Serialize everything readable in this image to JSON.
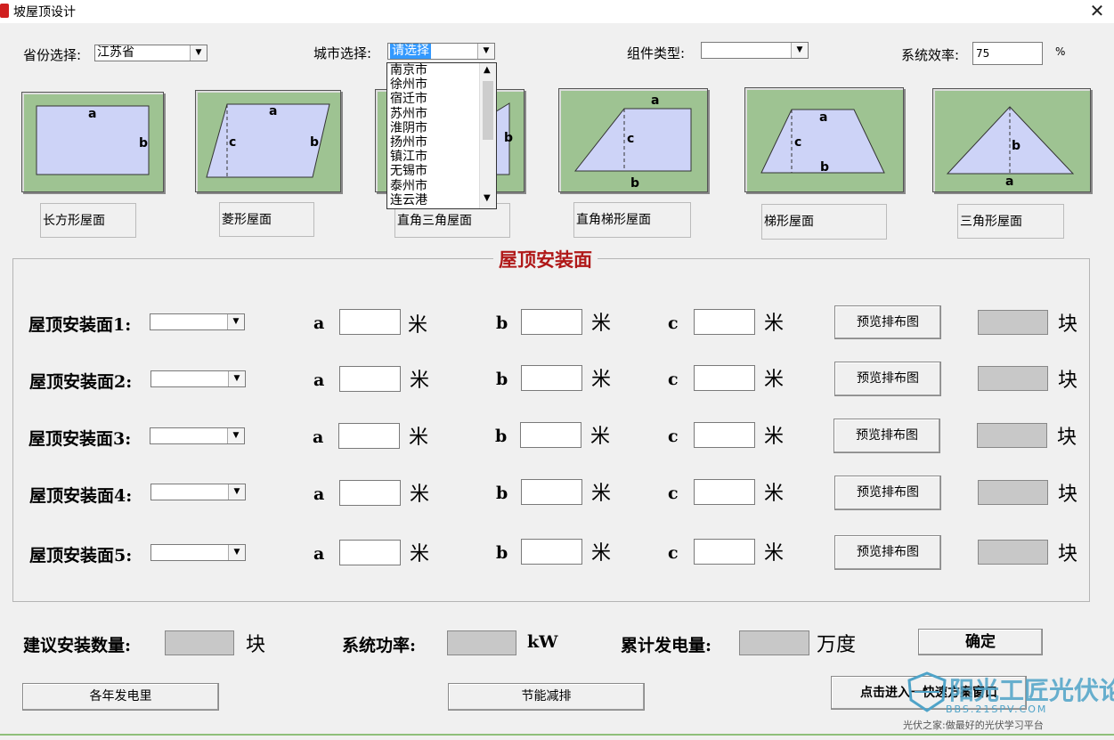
{
  "window": {
    "title": "坡屋顶设计",
    "close_glyph": "✕"
  },
  "top_row": {
    "province_label": "省份选择:",
    "province_value": "江苏省",
    "city_label": "城市选择:",
    "city_value": "请选择",
    "module_label": "组件类型:",
    "module_value": "",
    "efficiency_label": "系统效率:",
    "efficiency_value": "75",
    "efficiency_unit": "%"
  },
  "city_dropdown": {
    "options": [
      "南京市",
      "徐州市",
      "宿迁市",
      "苏州市",
      "淮阴市",
      "扬州市",
      "镇江市",
      "无锡市",
      "泰州市",
      "连云港"
    ]
  },
  "roof_types": [
    {
      "caption": "长方形屋面",
      "labels": [
        "a",
        "b"
      ]
    },
    {
      "caption": "菱形屋面",
      "labels": [
        "a",
        "c",
        "b"
      ]
    },
    {
      "caption": "直角三角屋面",
      "labels": [
        "b"
      ]
    },
    {
      "caption": "直角梯形屋面",
      "labels": [
        "a",
        "c",
        "b"
      ]
    },
    {
      "caption": "梯形屋面",
      "labels": [
        "a",
        "c",
        "b"
      ]
    },
    {
      "caption": "三角形屋面",
      "labels": [
        "b",
        "a"
      ]
    }
  ],
  "install_group": {
    "title": "屋顶安装面",
    "rows": [
      {
        "label": "屋顶安装面1:",
        "a_label": "a",
        "b_label": "b",
        "c_label": "c",
        "unit": "米",
        "preview": "预览排布图",
        "count_unit": "块"
      },
      {
        "label": "屋顶安装面2:",
        "a_label": "a",
        "b_label": "b",
        "c_label": "c",
        "unit": "米",
        "preview": "预览排布图",
        "count_unit": "块"
      },
      {
        "label": "屋顶安装面3:",
        "a_label": "a",
        "b_label": "b",
        "c_label": "c",
        "unit": "米",
        "preview": "预览排布图",
        "count_unit": "块"
      },
      {
        "label": "屋顶安装面4:",
        "a_label": "a",
        "b_label": "b",
        "c_label": "c",
        "unit": "米",
        "preview": "预览排布图",
        "count_unit": "块"
      },
      {
        "label": "屋顶安装面5:",
        "a_label": "a",
        "b_label": "b",
        "c_label": "c",
        "unit": "米",
        "preview": "预览排布图",
        "count_unit": "块"
      }
    ]
  },
  "summary": {
    "suggest_label": "建议安装数量:",
    "suggest_unit": "块",
    "power_label": "系统功率:",
    "power_unit": "kW",
    "energy_label": "累计发电量:",
    "energy_unit": "万度",
    "confirm": "确定"
  },
  "bottom_buttons": {
    "yearly": "各年发电里",
    "saving": "节能减排",
    "enter_fast": "点击进入一快速方案窗口"
  },
  "watermark": {
    "main": "阳光工匠光伏论坛",
    "url": "BBS.21SPV.COM",
    "tagline": "光伏之家:做最好的光伏学习平台"
  },
  "colors": {
    "roof_bg": "#9ec392",
    "roof_shape": "#cdd3f7",
    "group_title": "#b01818",
    "watermark": "#4fa3c8"
  }
}
